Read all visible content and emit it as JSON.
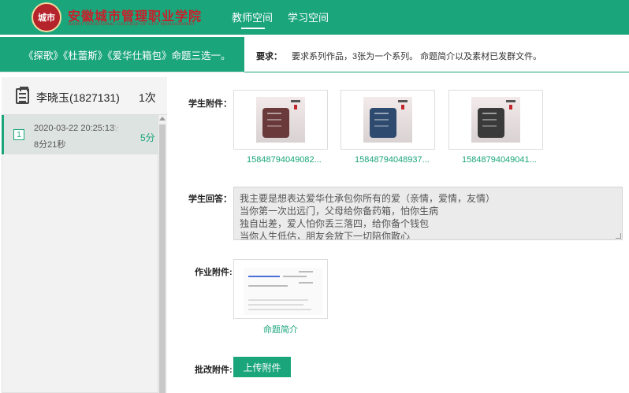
{
  "header": {
    "logo_badge": "城市",
    "school_name": "安徽城市管理职业学院",
    "school_name_en": "ANHUI VOCATIONAL COLLEGE OF CITY MANAGEMENT",
    "nav": [
      {
        "label": "教师空间",
        "active": true
      },
      {
        "label": "学习空间",
        "active": false
      }
    ]
  },
  "assignment": {
    "title": "《探歌》《杜蕾斯》《爱华仕箱包》命题三选一。",
    "requirement_label": "要求：",
    "requirement_text": "要求系列作品，3张为一个系列。 命题简介以及素材已发群文件。"
  },
  "student": {
    "icon": "document-list-icon",
    "name": "李晓玉(1827131)",
    "submission_count": "1次",
    "records": [
      {
        "index": "1",
        "time": "2020-03-22 20:25:13",
        "duration": "8分21秒",
        "score": "5分"
      }
    ]
  },
  "submission": {
    "attachments_label": "学生附件：",
    "attachments": [
      {
        "filename": "15848794049082...",
        "bag_color": "#6a3a3a"
      },
      {
        "filename": "15848794048937...",
        "bag_color": "#2e4a6e"
      },
      {
        "filename": "15848794049041...",
        "bag_color": "#3a3a3a"
      }
    ],
    "answer_label": "学生回答：",
    "answer_lines": [
      "我主要是想表达爱华仕承包你所有的爱（亲情，爱情，友情）",
      "当你第一次出远门，父母给你备药箱，怕你生病",
      "独自出差，爱人怕你丢三落四，给你备个钱包",
      "当你人生低估，朋友会放下一切陪你散心"
    ],
    "homework_label": "作业附件:",
    "homework_link": "命题简介",
    "review_label": "批改附件:",
    "upload_button": "上传附件"
  },
  "colors": {
    "primary": "#1aa57b",
    "logo_red": "#c8202a"
  }
}
